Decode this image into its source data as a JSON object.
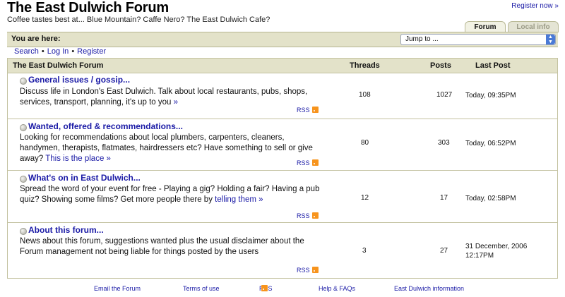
{
  "header": {
    "title": "The East Dulwich Forum",
    "tagline": "Coffee tastes best at... Blue Mountain? Caffe Nero? The East Dulwich Cafe?",
    "register_link": "Register now »"
  },
  "tabs": [
    {
      "label": "Forum",
      "active": true
    },
    {
      "label": "Local info",
      "active": false
    }
  ],
  "location_bar": {
    "label": "You are here:",
    "jump_select": "Jump to ..."
  },
  "nav_links": [
    "Search",
    "Log In",
    "Register"
  ],
  "table": {
    "headers": {
      "forum": "The East Dulwich Forum",
      "threads": "Threads",
      "posts": "Posts",
      "last_post": "Last Post"
    },
    "forums": [
      {
        "title": "General issues / gossip...",
        "description": "Discuss life in London's East Dulwich. Talk about local restaurants, pubs, shops, services, transport, planning, it's up to you",
        "link_text": "»",
        "rss": "RSS",
        "threads": "108",
        "posts": "1027",
        "last_post_line1": "Today, 09:35PM",
        "last_post_line2": ""
      },
      {
        "title": "Wanted, offered & recommendations...",
        "description": "Looking for recommendations about local plumbers, carpenters, cleaners, handymen, therapists, flatmates, hairdressers etc? Have something to sell or give away?",
        "link_text": "This is the place »",
        "rss": "RSS",
        "threads": "80",
        "posts": "303",
        "last_post_line1": "Today, 06:52PM",
        "last_post_line2": ""
      },
      {
        "title": "What's on in East Dulwich...",
        "description": "Spread the word of your event for free - Playing a gig? Holding a fair? Having a pub quiz? Showing some films? Get more people there by",
        "link_text": "telling them »",
        "rss": "RSS",
        "threads": "12",
        "posts": "17",
        "last_post_line1": "Today, 02:58PM",
        "last_post_line2": ""
      },
      {
        "title": "About this forum...",
        "description": "News about this forum, suggestions wanted plus the usual disclaimer about the Forum management not being liable for things posted by the users",
        "link_text": "",
        "rss": "RSS",
        "threads": "3",
        "posts": "27",
        "last_post_line1": "31 December, 2006",
        "last_post_line2": "12:17PM"
      }
    ]
  },
  "footer": {
    "email": "Email the Forum",
    "terms": "Terms of use",
    "rss": "RSS",
    "help": "Help & FAQs",
    "info": "East Dulwich information"
  },
  "icons": {
    "bullet": "forum-bullet-icon",
    "rss": "rss-icon",
    "select_arrows": "select-arrows-icon"
  },
  "colors": {
    "bar_background": "#e3e2c9",
    "link": "#1a1aa6",
    "rss_orange": "#f7941d"
  }
}
